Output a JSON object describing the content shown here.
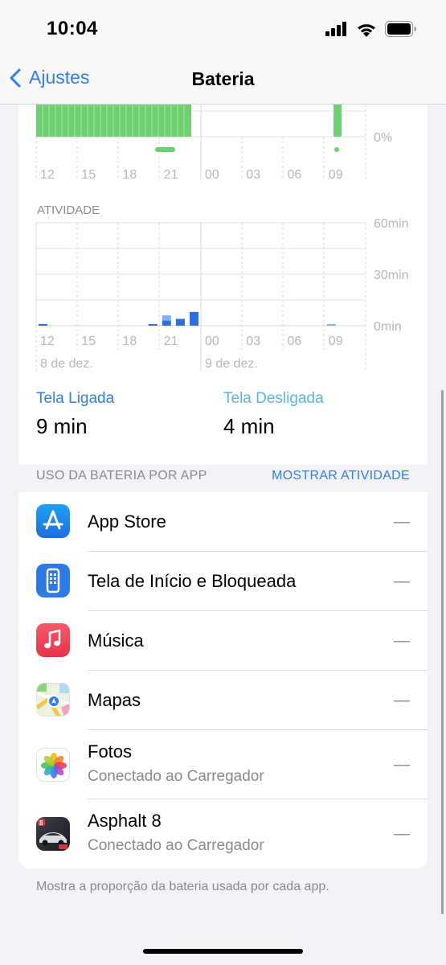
{
  "status": {
    "time": "10:04"
  },
  "nav": {
    "back_label": "Ajustes",
    "title": "Bateria"
  },
  "charts": {
    "time_labels": [
      "12",
      "15",
      "18",
      "21",
      "00",
      "03",
      "06",
      "09"
    ],
    "date_labels": [
      "8 de dez.",
      "9 de dez."
    ],
    "battery_level": {
      "y_label": "0%"
    },
    "activity": {
      "title": "ATIVIDADE",
      "y_labels": [
        "60min",
        "30min",
        "0min"
      ],
      "ylim": [
        0,
        60
      ],
      "colors": {
        "screen_on": "#2d6fe0",
        "screen_off": "#7fb6f0"
      }
    },
    "colors": {
      "battery_green": "#6cd16e",
      "grid": "#e3e3e8"
    }
  },
  "chart_data": {
    "type": "bar",
    "title": "ATIVIDADE",
    "ylabel": "",
    "ylim": [
      0,
      60
    ],
    "y_ticks": [
      "60min",
      "30min",
      "0min"
    ],
    "x_ticks": [
      "12",
      "15",
      "18",
      "21",
      "00",
      "03",
      "06",
      "09"
    ],
    "series": [
      {
        "name": "Tela Ligada",
        "points": [
          {
            "hour": 12.5,
            "minutes": 1
          },
          {
            "hour": 20.5,
            "minutes": 1
          },
          {
            "hour": 21.5,
            "minutes": 3
          },
          {
            "hour": 22.5,
            "minutes": 4
          },
          {
            "hour": 23.5,
            "minutes": 8
          }
        ]
      },
      {
        "name": "Tela Desligada",
        "points": [
          {
            "hour": 21.5,
            "minutes": 3
          },
          {
            "hour": 9.5,
            "minutes": 1
          }
        ]
      }
    ]
  },
  "stats": {
    "screen_on": {
      "label": "Tela Ligada",
      "value": "9 min",
      "color": "#2f7cf6"
    },
    "screen_off": {
      "label": "Tela Desligada",
      "value": "4 min",
      "color": "#5ab4ec"
    }
  },
  "section": {
    "title": "USO DA BATERIA POR APP",
    "action": "MOSTRAR ATIVIDADE"
  },
  "apps": [
    {
      "name": "App Store",
      "subtitle": "",
      "value": "—",
      "icon": "app-store-icon"
    },
    {
      "name": "Tela de Início e Bloqueada",
      "subtitle": "",
      "value": "—",
      "icon": "home-lock-screen-icon"
    },
    {
      "name": "Música",
      "subtitle": "",
      "value": "—",
      "icon": "music-icon"
    },
    {
      "name": "Mapas",
      "subtitle": "",
      "value": "—",
      "icon": "maps-icon"
    },
    {
      "name": "Fotos",
      "subtitle": "Conectado ao Carregador",
      "value": "—",
      "icon": "photos-icon"
    },
    {
      "name": "Asphalt 8",
      "subtitle": "Conectado ao Carregador",
      "value": "—",
      "icon": "asphalt-8-icon"
    }
  ],
  "footer": "Mostra a proporção da bateria usada por cada app."
}
